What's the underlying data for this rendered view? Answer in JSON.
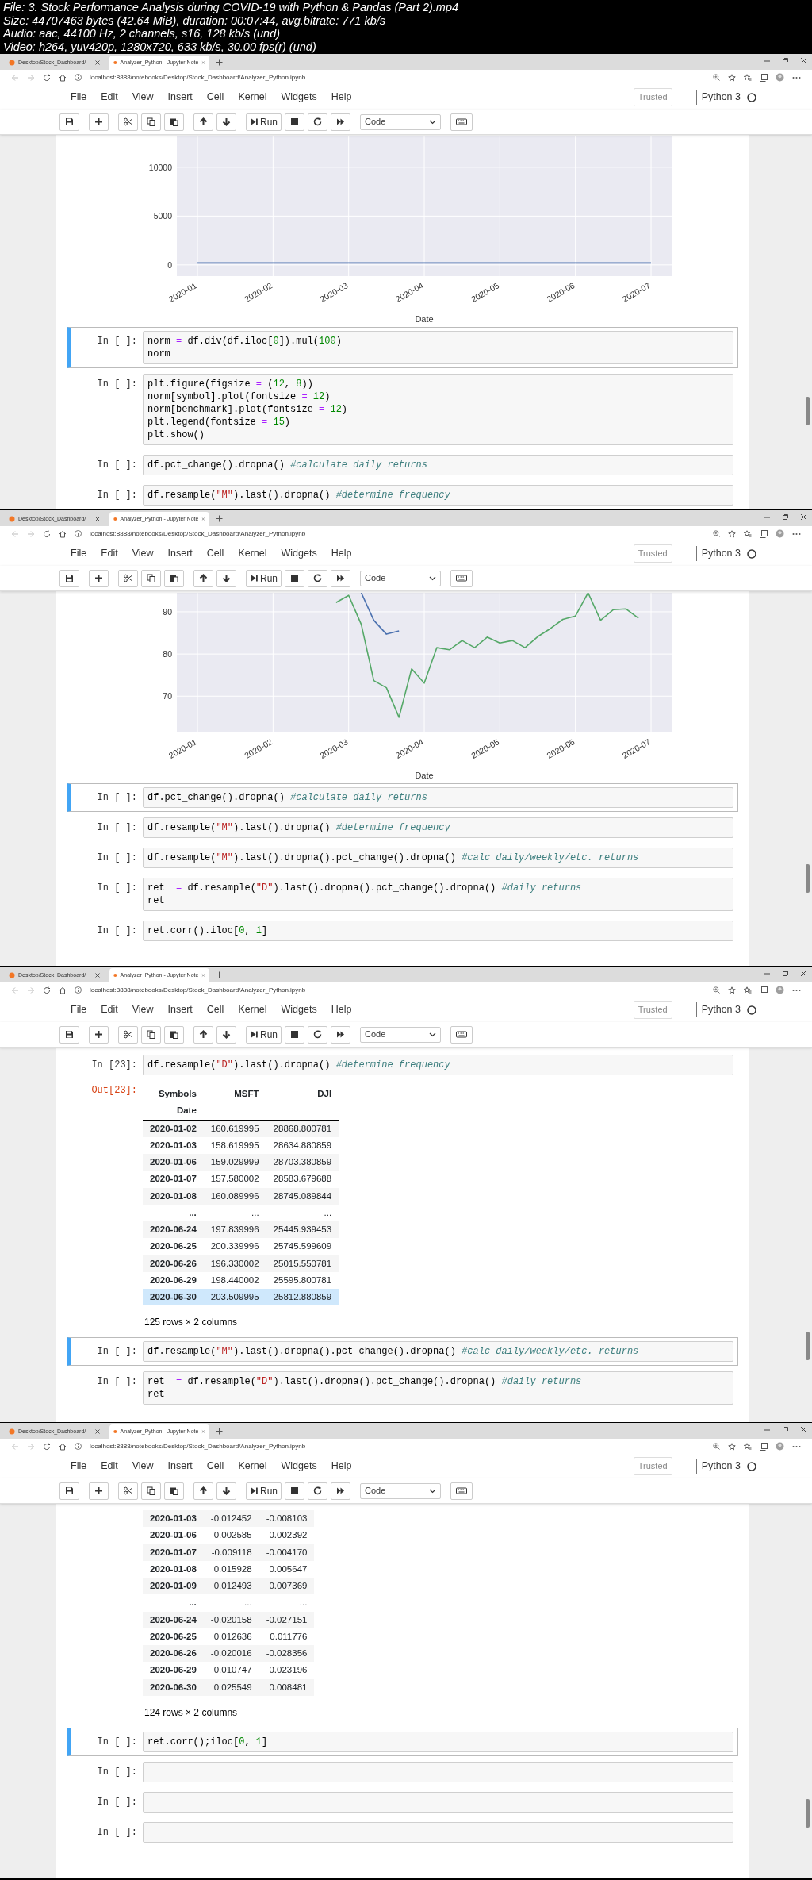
{
  "video_info": [
    "File: 3. Stock Performance Analysis during COVID-19 with Python & Pandas (Part 2).mp4",
    "Size: 44707463 bytes (42.64 MiB), duration: 00:07:44, avg.bitrate: 771 kb/s",
    "Audio: aac, 44100 Hz, 2 channels, s16, 128 kb/s (und)",
    "Video: h264, yuv420p, 1280x720, 633 kb/s, 30.00 fps(r) (und)"
  ],
  "frames": [
    {
      "browser": {
        "tabs": [
          {
            "title": "Desktop/Stock_Dashboard/",
            "selected": false
          },
          {
            "title": "Analyzer_Python - Jupyter Note",
            "selected": true
          }
        ],
        "url": "localhost:8888/notebooks/Desktop/Stock_Dashboard/Analyzer_Python.ipynb"
      },
      "menu": [
        "File",
        "Edit",
        "View",
        "Insert",
        "Cell",
        "Kernel",
        "Widgets",
        "Help"
      ],
      "trusted": "Trusted",
      "kernel": "Python 3",
      "toolbar": {
        "run_label": "Run",
        "cell_type": "Code"
      },
      "items": [
        {
          "kind": "chart",
          "chart_data": {
            "type": "line",
            "xlabel": "Date",
            "categories": [
              "2020-01",
              "2020-02",
              "2020-03",
              "2020-04",
              "2020-05",
              "2020-06",
              "2020-07"
            ],
            "series": [
              {
                "color": "#4c72b0",
                "values": [
                  200,
                  200,
                  200,
                  200,
                  200,
                  200,
                  200
                ]
              }
            ],
            "ylim": [
              -1150,
              13160
            ],
            "yticks": [
              0,
              5000,
              10000
            ],
            "grid": true
          }
        },
        {
          "kind": "cell",
          "prompt": "In [ ]:",
          "selected": true,
          "lines": [
            "norm = df.div(df.iloc[0]).mul(100)",
            "norm"
          ]
        },
        {
          "kind": "cell",
          "prompt": "In [ ]:",
          "selected": false,
          "lines": [
            "plt.figure(figsize = (12, 8))",
            "norm[symbol].plot(fontsize = 12)",
            "norm[benchmark].plot(fontsize = 12)",
            "plt.legend(fontsize = 15)",
            "plt.show()"
          ]
        },
        {
          "kind": "cell",
          "prompt": "In [ ]:",
          "selected": false,
          "lines": [
            "df.pct_change().dropna() #calculate daily returns"
          ]
        },
        {
          "kind": "cell",
          "prompt": "In [ ]:",
          "selected": false,
          "lines": [
            "df.resample(\"M\").last().dropna() #determine frequency"
          ]
        }
      ]
    },
    {
      "browser": {
        "tabs": [
          {
            "title": "Desktop/Stock_Dashboard/",
            "selected": false
          },
          {
            "title": "Analyzer_Python - Jupyter Note",
            "selected": true
          }
        ],
        "url": "localhost:8888/notebooks/Desktop/Stock_Dashboard/Analyzer_Python.ipynb"
      },
      "menu": [
        "File",
        "Edit",
        "View",
        "Insert",
        "Cell",
        "Kernel",
        "Widgets",
        "Help"
      ],
      "trusted": "Trusted",
      "kernel": "Python 3",
      "toolbar": {
        "run_label": "Run",
        "cell_type": "Code"
      },
      "items": [
        {
          "kind": "chart",
          "chart_data": {
            "type": "line",
            "xlabel": "Date",
            "categories": [
              "2020-01",
              null,
              null,
              null,
              null,
              null,
              "2020-02",
              null,
              null,
              null,
              null,
              null,
              "2020-03",
              null,
              null,
              null,
              null,
              null,
              "2020-04",
              null,
              null,
              null,
              null,
              null,
              "2020-05",
              null,
              null,
              null,
              null,
              null,
              "2020-06",
              null,
              null,
              null,
              null,
              null,
              "2020-07"
            ],
            "series": [
              {
                "color": "#4c72b0",
                "values": [
                  null,
                  null,
                  null,
                  null,
                  null,
                  null,
                  null,
                  null,
                  null,
                  null,
                  null,
                  null,
                  null,
                  94.5,
                  88,
                  84.7,
                  85.5,
                  null,
                  null,
                  null,
                  null,
                  null,
                  null,
                  null,
                  null,
                  null,
                  null,
                  null,
                  null,
                  null,
                  null,
                  null,
                  null,
                  null,
                  null,
                  null,
                  null
                ]
              },
              {
                "color": "#55a868",
                "values": [
                  null,
                  null,
                  null,
                  null,
                  null,
                  null,
                  null,
                  null,
                  null,
                  null,
                  null,
                  92.2,
                  93.9,
                  87,
                  73.7,
                  72,
                  65,
                  76.5,
                  73.1,
                  81.5,
                  81,
                  83.2,
                  81.5,
                  84,
                  82.6,
                  83.2,
                  81.5,
                  84.1,
                  86,
                  88.2,
                  89,
                  94.5,
                  88,
                  90.5,
                  90.7,
                  88.5,
                  null
                ]
              }
            ],
            "ylim": [
              61.4,
              94.5
            ],
            "yticks": [
              70,
              80,
              90
            ],
            "grid": true
          }
        },
        {
          "kind": "cell",
          "prompt": "In [ ]:",
          "selected": true,
          "lines": [
            "df.pct_change().dropna() #calculate daily returns"
          ]
        },
        {
          "kind": "cell",
          "prompt": "In [ ]:",
          "selected": false,
          "lines": [
            "df.resample(\"M\").last().dropna() #determine frequency"
          ]
        },
        {
          "kind": "cell",
          "prompt": "In [ ]:",
          "selected": false,
          "lines": [
            "df.resample(\"M\").last().dropna().pct_change().dropna() #calc daily/weekly/etc. returns"
          ]
        },
        {
          "kind": "cell",
          "prompt": "In [ ]:",
          "selected": false,
          "lines": [
            "ret  = df.resample(\"D\").last().dropna().pct_change().dropna() #daily returns",
            "ret"
          ]
        },
        {
          "kind": "cell",
          "prompt": "In [ ]:",
          "selected": false,
          "lines": [
            "ret.corr().iloc[0, 1]"
          ]
        }
      ]
    },
    {
      "browser": {
        "tabs": [
          {
            "title": "Desktop/Stock_Dashboard/",
            "selected": false
          },
          {
            "title": "Analyzer_Python - Jupyter Note",
            "selected": true
          }
        ],
        "url": "localhost:8888/notebooks/Desktop/Stock_Dashboard/Analyzer_Python.ipynb"
      },
      "menu": [
        "File",
        "Edit",
        "View",
        "Insert",
        "Cell",
        "Kernel",
        "Widgets",
        "Help"
      ],
      "trusted": "Trusted",
      "kernel": "Python 3",
      "toolbar": {
        "run_label": "Run",
        "cell_type": "Code"
      },
      "items": [
        {
          "kind": "cell",
          "prompt": "In [23]:",
          "selected": false,
          "lines": [
            "df.resample(\"D\").last().dropna() #determine frequency"
          ]
        },
        {
          "kind": "output",
          "prompt": "Out[23]:",
          "columns": [
            "Symbols",
            "MSFT",
            "DJI"
          ],
          "index_name": "Date",
          "footer": "125 rows × 2 columns",
          "rows": [
            {
              "index": "2020-01-02",
              "values": [
                "160.619995",
                "28868.800781"
              ],
              "highlighted": false
            },
            {
              "index": "2020-01-03",
              "values": [
                "158.619995",
                "28634.880859"
              ],
              "highlighted": false
            },
            {
              "index": "2020-01-06",
              "values": [
                "159.029999",
                "28703.380859"
              ],
              "highlighted": false
            },
            {
              "index": "2020-01-07",
              "values": [
                "157.580002",
                "28583.679688"
              ],
              "highlighted": false
            },
            {
              "index": "2020-01-08",
              "values": [
                "160.089996",
                "28745.089844"
              ],
              "highlighted": false
            },
            {
              "index": "...",
              "values": [
                "...",
                "..."
              ],
              "highlighted": false
            },
            {
              "index": "2020-06-24",
              "values": [
                "197.839996",
                "25445.939453"
              ],
              "highlighted": false
            },
            {
              "index": "2020-06-25",
              "values": [
                "200.339996",
                "25745.599609"
              ],
              "highlighted": false
            },
            {
              "index": "2020-06-26",
              "values": [
                "196.330002",
                "25015.550781"
              ],
              "highlighted": false
            },
            {
              "index": "2020-06-29",
              "values": [
                "198.440002",
                "25595.800781"
              ],
              "highlighted": false
            },
            {
              "index": "2020-06-30",
              "values": [
                "203.509995",
                "25812.880859"
              ],
              "highlighted": true
            }
          ]
        },
        {
          "kind": "cell",
          "prompt": "In [ ]:",
          "selected": true,
          "lines": [
            "df.resample(\"M\").last().dropna().pct_change().dropna() #calc daily/weekly/etc. returns"
          ]
        },
        {
          "kind": "cell",
          "prompt": "In [ ]:",
          "selected": false,
          "lines": [
            "ret  = df.resample(\"D\").last().dropna().pct_change().dropna() #daily returns",
            "ret"
          ]
        }
      ]
    },
    {
      "browser": {
        "tabs": [
          {
            "title": "Desktop/Stock_Dashboard/",
            "selected": false
          },
          {
            "title": "Analyzer_Python - Jupyter Note",
            "selected": true
          }
        ],
        "url": "localhost:8888/notebooks/Desktop/Stock_Dashboard/Analyzer_Python.ipynb"
      },
      "menu": [
        "File",
        "Edit",
        "View",
        "Insert",
        "Cell",
        "Kernel",
        "Widgets",
        "Help"
      ],
      "trusted": "Trusted",
      "kernel": "Python 3",
      "toolbar": {
        "run_label": "Run",
        "cell_type": "Code"
      },
      "items": [
        {
          "kind": "output",
          "footer": "124 rows × 2 columns",
          "rows": [
            {
              "index": "2020-01-03",
              "values": [
                "-0.012452",
                "-0.008103"
              ],
              "highlighted": false
            },
            {
              "index": "2020-01-06",
              "values": [
                "0.002585",
                "0.002392"
              ],
              "highlighted": false
            },
            {
              "index": "2020-01-07",
              "values": [
                "-0.009118",
                "-0.004170"
              ],
              "highlighted": false
            },
            {
              "index": "2020-01-08",
              "values": [
                "0.015928",
                "0.005647"
              ],
              "highlighted": false
            },
            {
              "index": "2020-01-09",
              "values": [
                "0.012493",
                "0.007369"
              ],
              "highlighted": false
            },
            {
              "index": "...",
              "values": [
                "...",
                "..."
              ],
              "highlighted": false
            },
            {
              "index": "2020-06-24",
              "values": [
                "-0.020158",
                "-0.027151"
              ],
              "highlighted": false
            },
            {
              "index": "2020-06-25",
              "values": [
                "0.012636",
                "0.011776"
              ],
              "highlighted": false
            },
            {
              "index": "2020-06-26",
              "values": [
                "-0.020016",
                "-0.028356"
              ],
              "highlighted": false
            },
            {
              "index": "2020-06-29",
              "values": [
                "0.010747",
                "0.023196"
              ],
              "highlighted": false
            },
            {
              "index": "2020-06-30",
              "values": [
                "0.025549",
                "0.008481"
              ],
              "highlighted": false
            }
          ]
        },
        {
          "kind": "cell",
          "prompt": "In [ ]:",
          "selected": true,
          "lines": [
            "ret.corr();iloc[0, 1]"
          ]
        },
        {
          "kind": "cell",
          "prompt": "In [ ]:",
          "selected": false
        },
        {
          "kind": "cell",
          "prompt": "In [ ]:",
          "selected": false
        },
        {
          "kind": "cell",
          "prompt": "In [ ]:",
          "selected": false
        }
      ]
    }
  ]
}
